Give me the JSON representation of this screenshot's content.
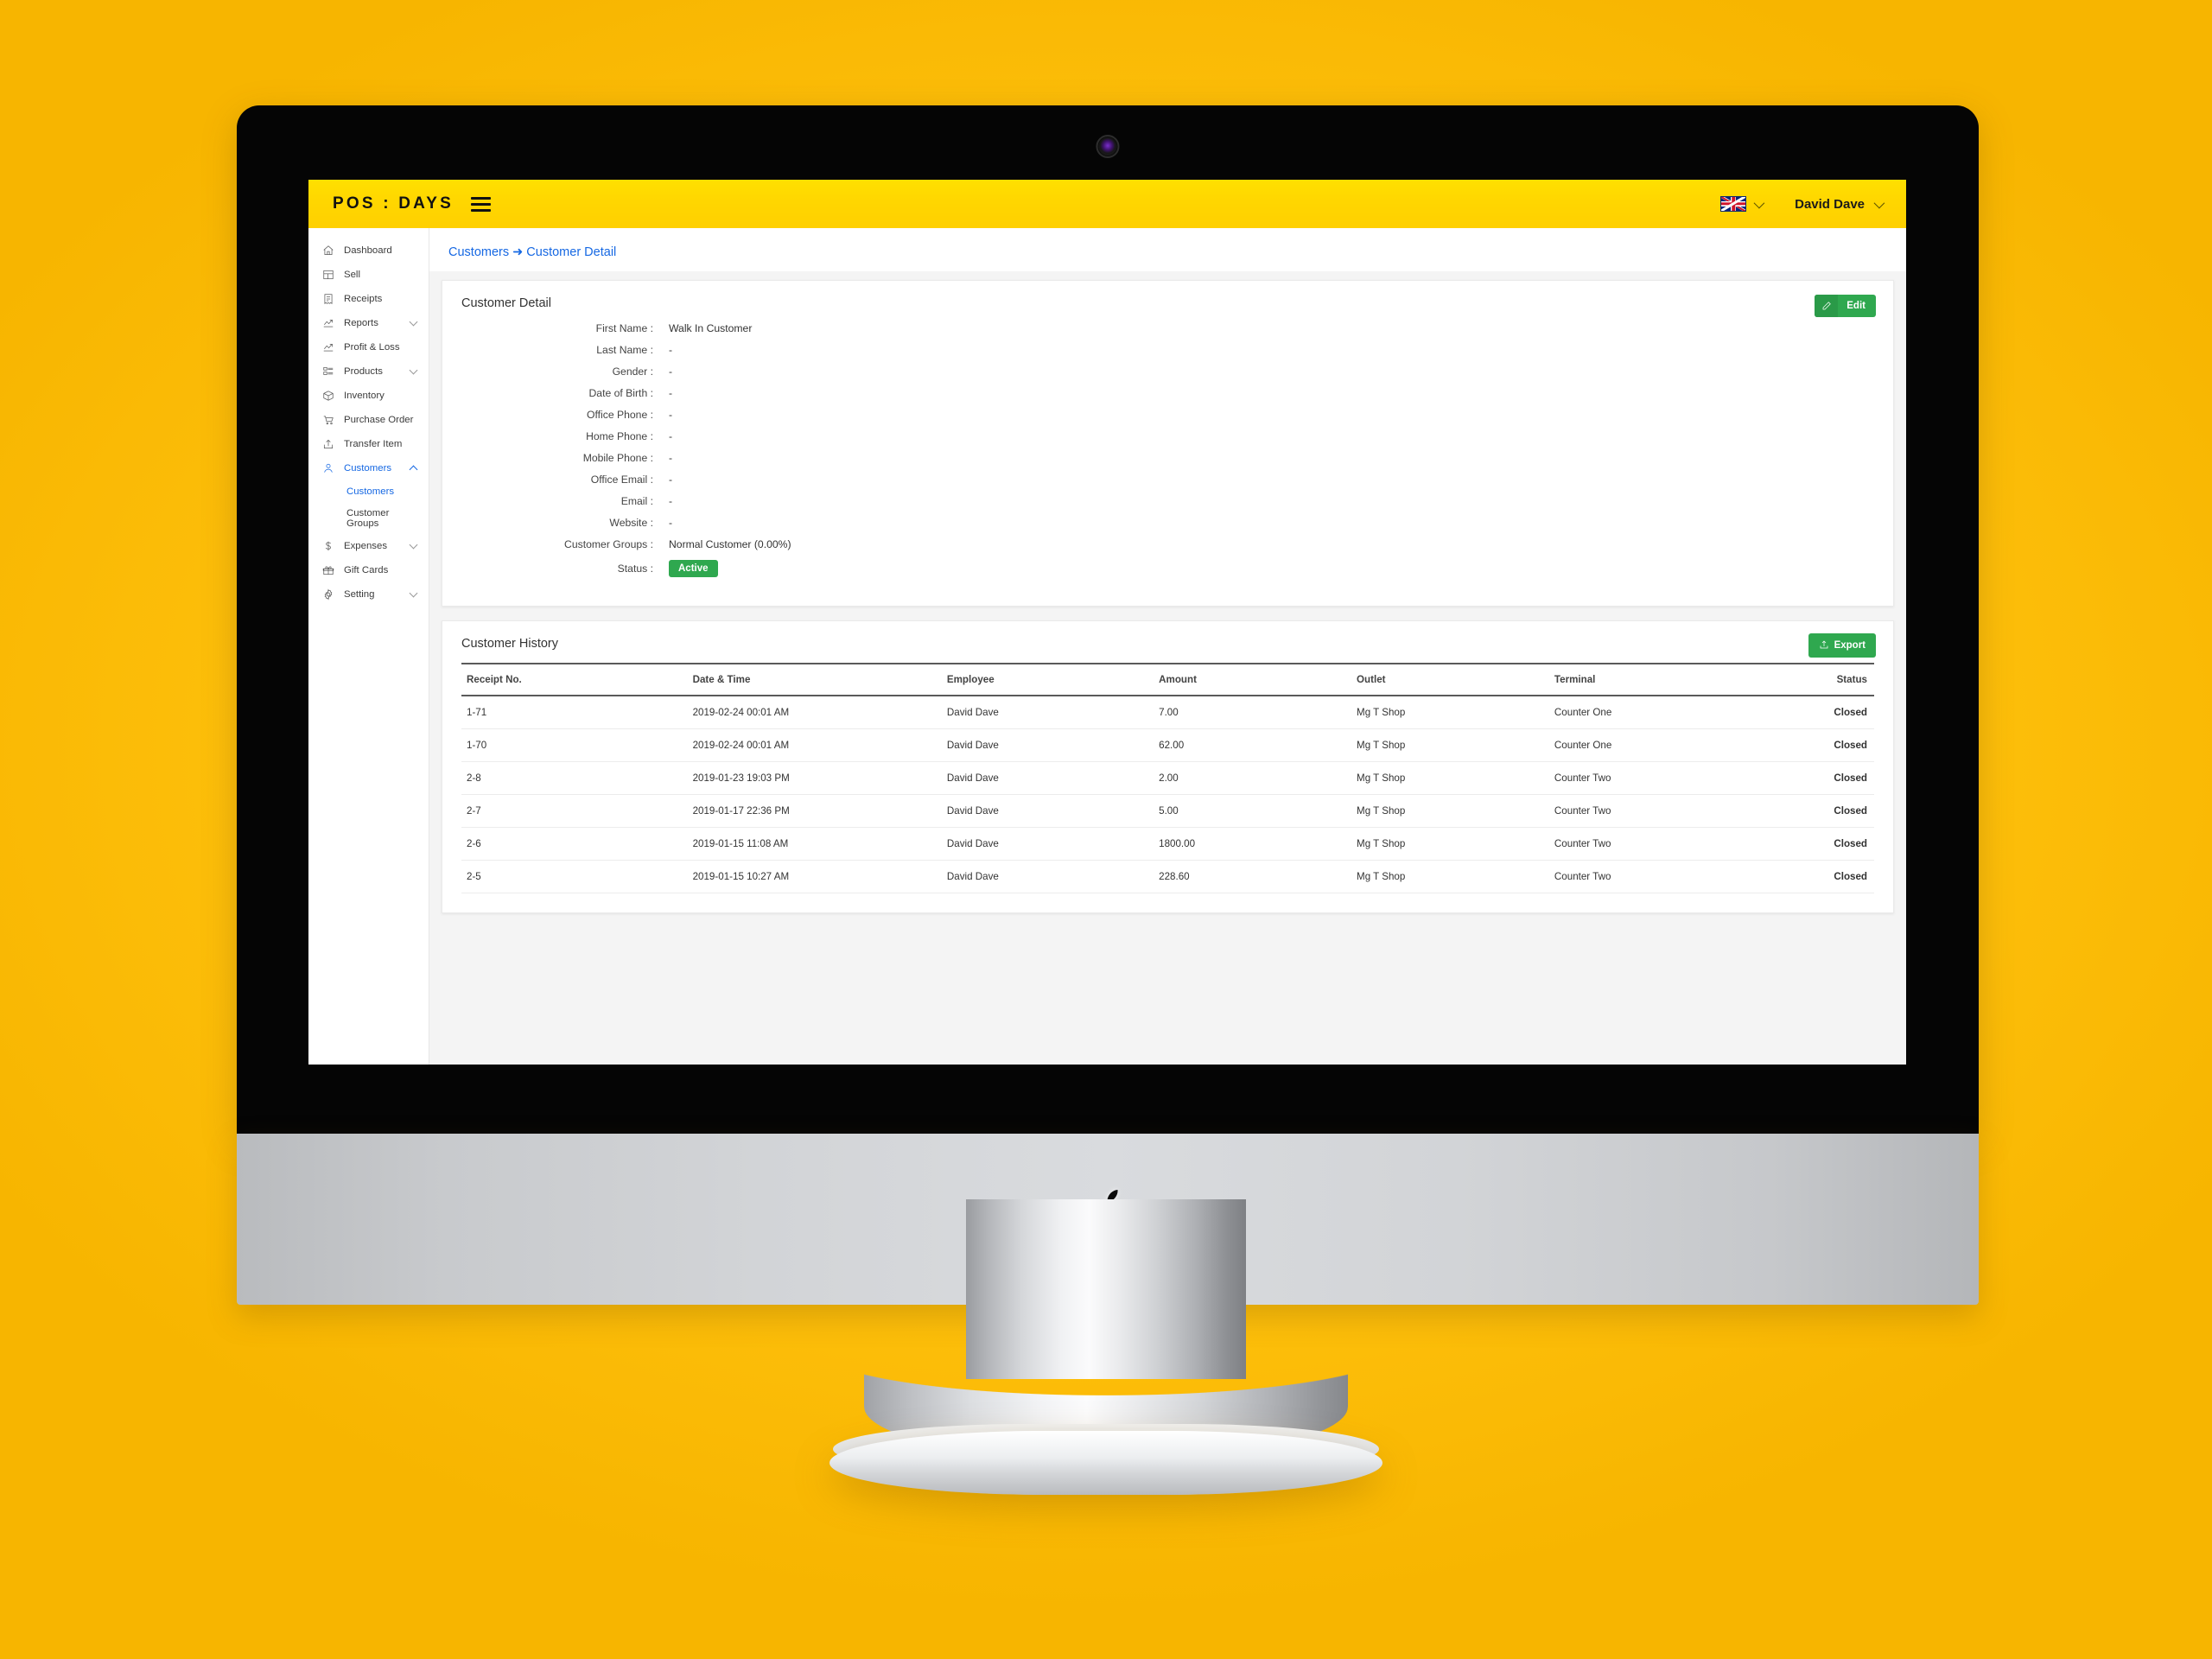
{
  "appbar": {
    "brand": "POS : DAYS",
    "menu_icon": "hamburger-icon",
    "language_flag": "uk-flag-icon",
    "username": "David Dave"
  },
  "sidebar": {
    "items": [
      {
        "label": "Dashboard",
        "icon": "home-icon",
        "expandable": false,
        "active": false
      },
      {
        "label": "Sell",
        "icon": "layout-icon",
        "expandable": false,
        "active": false
      },
      {
        "label": "Receipts",
        "icon": "receipt-icon",
        "expandable": false,
        "active": false
      },
      {
        "label": "Reports",
        "icon": "trending-up-icon",
        "expandable": true,
        "active": false
      },
      {
        "label": "Profit & Loss",
        "icon": "trending-up-icon",
        "expandable": false,
        "active": false
      },
      {
        "label": "Products",
        "icon": "list-icon",
        "expandable": true,
        "active": false
      },
      {
        "label": "Inventory",
        "icon": "box-icon",
        "expandable": false,
        "active": false
      },
      {
        "label": "Purchase Order",
        "icon": "cart-icon",
        "expandable": false,
        "active": false
      },
      {
        "label": "Transfer Item",
        "icon": "share-icon",
        "expandable": false,
        "active": false
      },
      {
        "label": "Customers",
        "icon": "user-icon",
        "expandable": true,
        "active": true
      }
    ],
    "subitems": [
      {
        "label": "Customers",
        "active": true
      },
      {
        "label": "Customer Groups",
        "active": false
      }
    ],
    "items_after": [
      {
        "label": "Expenses",
        "icon": "dollar-icon",
        "expandable": true,
        "active": false
      },
      {
        "label": "Gift Cards",
        "icon": "gift-icon",
        "expandable": false,
        "active": false
      },
      {
        "label": "Setting",
        "icon": "gear-icon",
        "expandable": true,
        "active": false
      }
    ]
  },
  "breadcrumb": "Customers ➜ Customer Detail",
  "customer_detail": {
    "title": "Customer Detail",
    "edit_label": "Edit",
    "edit_icon": "pencil-icon",
    "fields": [
      {
        "label": "First Name :",
        "value": "Walk In Customer"
      },
      {
        "label": "Last Name :",
        "value": "-"
      },
      {
        "label": "Gender :",
        "value": "-"
      },
      {
        "label": "Date of Birth :",
        "value": "-"
      },
      {
        "label": "Office Phone :",
        "value": "-"
      },
      {
        "label": "Home Phone :",
        "value": "-"
      },
      {
        "label": "Mobile Phone :",
        "value": "-"
      },
      {
        "label": "Office Email :",
        "value": "-"
      },
      {
        "label": "Email :",
        "value": "-"
      },
      {
        "label": "Website :",
        "value": "-"
      },
      {
        "label": "Customer Groups :",
        "value": "Normal Customer (0.00%)"
      }
    ],
    "status_label": "Status :",
    "status_value": "Active",
    "status_color": "#2fa84f"
  },
  "customer_history": {
    "title": "Customer History",
    "export_label": "Export",
    "export_icon": "upload-icon",
    "columns": [
      "Receipt No.",
      "Date & Time",
      "Employee",
      "Amount",
      "Outlet",
      "Terminal",
      "Status"
    ],
    "rows": [
      {
        "receipt": "1-71",
        "datetime": "2019-02-24 00:01 AM",
        "employee": "David Dave",
        "amount": "7.00",
        "outlet": "Mg T Shop",
        "terminal": "Counter One",
        "status": "Closed"
      },
      {
        "receipt": "1-70",
        "datetime": "2019-02-24 00:01 AM",
        "employee": "David Dave",
        "amount": "62.00",
        "outlet": "Mg T Shop",
        "terminal": "Counter One",
        "status": "Closed"
      },
      {
        "receipt": "2-8",
        "datetime": "2019-01-23 19:03 PM",
        "employee": "David Dave",
        "amount": "2.00",
        "outlet": "Mg T Shop",
        "terminal": "Counter Two",
        "status": "Closed"
      },
      {
        "receipt": "2-7",
        "datetime": "2019-01-17 22:36 PM",
        "employee": "David Dave",
        "amount": "5.00",
        "outlet": "Mg T Shop",
        "terminal": "Counter Two",
        "status": "Closed"
      },
      {
        "receipt": "2-6",
        "datetime": "2019-01-15 11:08 AM",
        "employee": "David Dave",
        "amount": "1800.00",
        "outlet": "Mg T Shop",
        "terminal": "Counter Two",
        "status": "Closed"
      },
      {
        "receipt": "2-5",
        "datetime": "2019-01-15 10:27 AM",
        "employee": "David Dave",
        "amount": "228.60",
        "outlet": "Mg T Shop",
        "terminal": "Counter Two",
        "status": "Closed"
      }
    ]
  },
  "device": {
    "brand_logo": "apple-logo",
    "webcam": "webcam-icon"
  },
  "colors": {
    "page_background": "#FFC20E",
    "appbar": "#FFD600",
    "accent_link": "#1668e3",
    "active_indicator": "#F8325A",
    "success": "#2fa84f"
  }
}
